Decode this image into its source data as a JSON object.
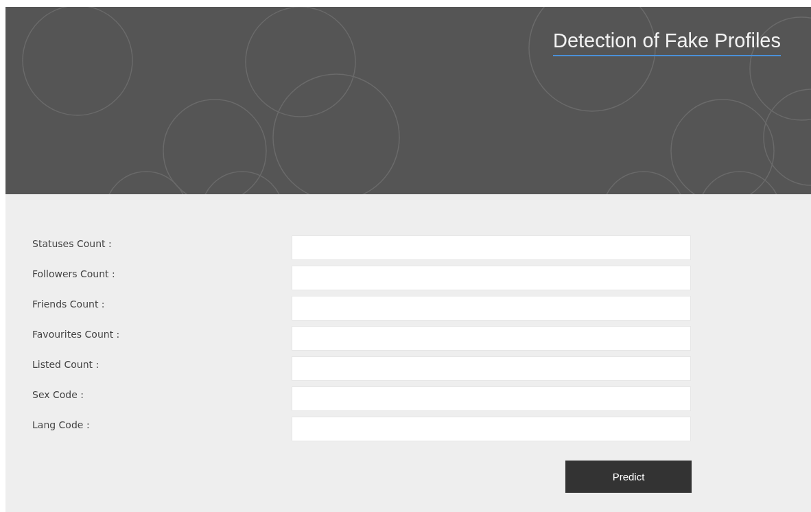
{
  "header": {
    "title": "Detection of Fake Profiles"
  },
  "form": {
    "fields": [
      {
        "label": "Statuses Count :"
      },
      {
        "label": "Followers Count :"
      },
      {
        "label": "Friends Count :"
      },
      {
        "label": "Favourites Count :"
      },
      {
        "label": "Listed Count :"
      },
      {
        "label": "Sex Code :"
      },
      {
        "label": "Lang Code :"
      }
    ],
    "submit": "Predict"
  }
}
